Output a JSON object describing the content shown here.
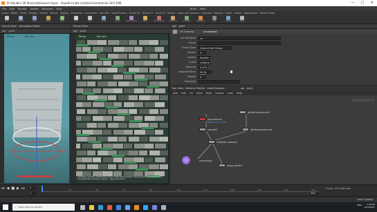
{
  "window": {
    "title": "D:/Houdini 18 files/callsHouse1.hipnc - Houdini Indie Limited-Commercial 18.5.696",
    "controls": [
      "—",
      "□",
      "✕"
    ]
  },
  "menubar": [
    "File",
    "Edit",
    "Render",
    "Assets",
    "Windows",
    "Help",
    "Build",
    "Main"
  ],
  "shelf": {
    "tabs": [
      "Create",
      "Modify",
      "Model",
      "Polygon",
      "Deform",
      "Texture",
      "Rigging",
      "Characters",
      "Constraints",
      "Hair Utils",
      "Guide Process",
      "Terrain FX",
      "Simple FX",
      "Cloud FX",
      "Volume",
      "Lights and Cameras",
      "Collisions",
      "Particles",
      "Grains",
      "Vellum",
      "Rigid Bodies",
      "Particle Fluids",
      "Viscous Fluids",
      "Oceans",
      "Fluid Containers",
      "Populate Containers",
      "Container Tools",
      "Pyro FX",
      "Sparse Pyro FX",
      "FEM",
      "Wires",
      "Crowds",
      "Drive Simulation"
    ],
    "tools": [
      {
        "name": "Box",
        "color": "#c9c9c9"
      },
      {
        "name": "Sphere",
        "color": "#9fb0d0"
      },
      {
        "name": "Tube",
        "color": "#8aa0c8"
      },
      {
        "name": "Torus",
        "color": "#c9a44d"
      },
      {
        "name": "Grid",
        "color": "#8fbf7c"
      },
      {
        "name": "Null",
        "color": "#d2d2d2"
      },
      {
        "name": "Line",
        "color": "#c8c8c8"
      },
      {
        "name": "Circle",
        "color": "#7fa9c7"
      },
      {
        "name": "Curve",
        "color": "#7fa97a"
      },
      {
        "name": "Draw Curve",
        "color": "#a88bc9"
      },
      {
        "name": "Path",
        "color": "#d0b35a"
      },
      {
        "name": "Spray Paint",
        "color": "#cf6c6c"
      },
      {
        "name": "Platonic",
        "color": "#caa26b"
      },
      {
        "name": "L-System",
        "color": "#7cb279"
      },
      {
        "name": "Metaball",
        "color": "#d58c4d"
      },
      {
        "name": "File",
        "color": "#8c8c8c"
      },
      {
        "name": "Spiral",
        "color": "#6fa0c9"
      },
      {
        "name": "Helix",
        "color": "#b6b6b6"
      }
    ]
  },
  "viewport_left": {
    "tabs": [
      "Scene View",
      "Animation Editor"
    ],
    "path": "obj",
    "node": "grid1",
    "camera": "Persp",
    "cam2": "No cam"
  },
  "viewport_mid": {
    "tabs": [
      "Scene View"
    ],
    "path": "obj",
    "node": "grid1",
    "camera": "Persp",
    "cam2": "No cam",
    "overlay_text": "Left Mouse Tumbles. Middle Mouse Pans. Right Mouse Dollies. Ctrl+Alt+Left Mouse Box Zooms. Ctrl+Right Mouse Zooms. Space+... Space+Z Zoom ..."
  },
  "params": {
    "header_path": "obj",
    "header_node": "grid1",
    "node_type": "UV Unwrap",
    "node_name": "uvunwrap1",
    "rows": [
      {
        "label": "UV Attribute",
        "value": "uv"
      },
      {
        "label": "Group",
        "value": ""
      },
      {
        "label": "Group Type",
        "value": "Guess from Group"
      },
      {
        "label": "Planes",
        "value": "0"
      },
      {
        "label": "Layout",
        "value": "Scatter"
      },
      {
        "label": "Scale",
        "value": "Uniform"
      },
      {
        "label": "Spacing",
        "value": "0.472"
      },
      {
        "label": "Nearest Plane",
        "value": "Fit To Grid"
      },
      {
        "label": "Rotate",
        "value": "0"
      },
      {
        "label": "Translate",
        "value": ""
      }
    ]
  },
  "network": {
    "tabs": [
      "Tree View",
      "Material Palette",
      "Asset Browser"
    ],
    "path": "obj",
    "node": "grid1",
    "menus": [
      "Add",
      "Edit",
      "Go",
      "View",
      "Tools",
      "Layout",
      "Labs",
      "Help"
    ],
    "context_label": "Geometry",
    "nodes": [
      {
        "name": "attribfromvolume2",
        "red": false,
        "sub": ""
      },
      {
        "name": "polyreduce2",
        "red": true,
        "sub": "Reduced to 1.0k%"
      },
      {
        "name": "normal2",
        "red": false,
        "sub": ""
      },
      {
        "name": "attribfromvolume1",
        "red": false,
        "sub": ""
      },
      {
        "name": "uvflatten_sweep1",
        "red": false,
        "sub": ""
      },
      {
        "name": "uvunwrap1",
        "red": false,
        "sub": ""
      },
      {
        "name": "maps_baker1",
        "red": false,
        "sub": ""
      }
    ]
  },
  "timeline": {
    "frame": "1",
    "start": "1",
    "end": "240",
    "ticks": [
      "1",
      "24",
      "48",
      "72",
      "96",
      "120",
      "144",
      "168",
      "192",
      "216",
      "240"
    ],
    "keys_label": "0 keys, 0/0 channels",
    "auto_update": "Auto Update"
  },
  "taskbar": {
    "search": "Type here to search",
    "time": "2:06 PM",
    "date": "9/15/2021",
    "lang": "ENG"
  }
}
